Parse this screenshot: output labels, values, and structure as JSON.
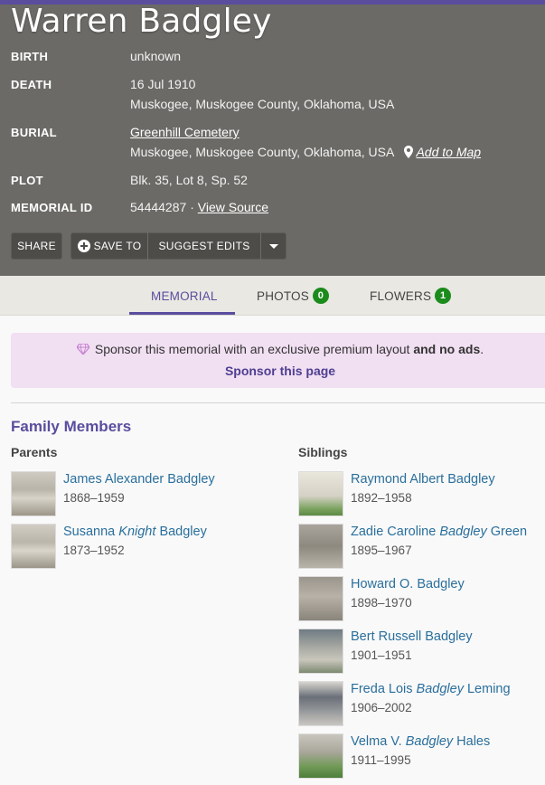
{
  "memorial": {
    "name": "Warren Badgley",
    "birth_label": "BIRTH",
    "birth_value": "unknown",
    "death_label": "DEATH",
    "death_date": "16 Jul 1910",
    "death_place": "Muskogee, Muskogee County, Oklahoma, USA",
    "burial_label": "BURIAL",
    "burial_cemetery": "Greenhill Cemetery",
    "burial_place": "Muskogee, Muskogee County, Oklahoma, USA",
    "add_to_map": "Add to Map",
    "plot_label": "PLOT",
    "plot_value": "Blk. 35, Lot 8, Sp. 52",
    "id_label": "MEMORIAL ID",
    "id_value": "54444287",
    "id_separator": "·",
    "view_source": "View Source"
  },
  "actions": {
    "share": "SHARE",
    "save_to": "SAVE TO",
    "suggest_edits": "SUGGEST EDITS"
  },
  "tabs": [
    {
      "label": "MEMORIAL"
    },
    {
      "label": "PHOTOS",
      "count": "0"
    },
    {
      "label": "FLOWERS",
      "count": "1"
    }
  ],
  "sponsor": {
    "text_pre": "Sponsor this memorial with an exclusive premium layout",
    "text_bold": "and no ads",
    "text_post": ".",
    "link": "Sponsor this page"
  },
  "family": {
    "title": "Family Members",
    "parents_label": "Parents",
    "siblings_label": "Siblings",
    "parents": [
      {
        "first": "James Alexander",
        "maiden": "",
        "last": "Badgley",
        "dates": "1868–1959"
      },
      {
        "first": "Susanna",
        "maiden": "Knight",
        "last": "Badgley",
        "dates": "1873–1952"
      }
    ],
    "siblings": [
      {
        "first": "Raymond Albert",
        "maiden": "",
        "last": "Badgley",
        "dates": "1892–1958"
      },
      {
        "first": "Zadie Caroline",
        "maiden": "Badgley",
        "last": "Green",
        "dates": "1895–1967"
      },
      {
        "first": "Howard O.",
        "maiden": "",
        "last": "Badgley",
        "dates": "1898–1970"
      },
      {
        "first": "Bert Russell",
        "maiden": "",
        "last": "Badgley",
        "dates": "1901–1951"
      },
      {
        "first": "Freda Lois",
        "maiden": "Badgley",
        "last": "Leming",
        "dates": "1906–2002"
      },
      {
        "first": "Velma V.",
        "maiden": "Badgley",
        "last": "Hales",
        "dates": "1911–1995"
      }
    ]
  },
  "colors": {
    "accent": "#5a4d9e",
    "hero_bg": "#6b6a66",
    "link": "#2a6f9c",
    "badge": "#1b8b1b",
    "sponsor_bg": "#f1dff2"
  }
}
